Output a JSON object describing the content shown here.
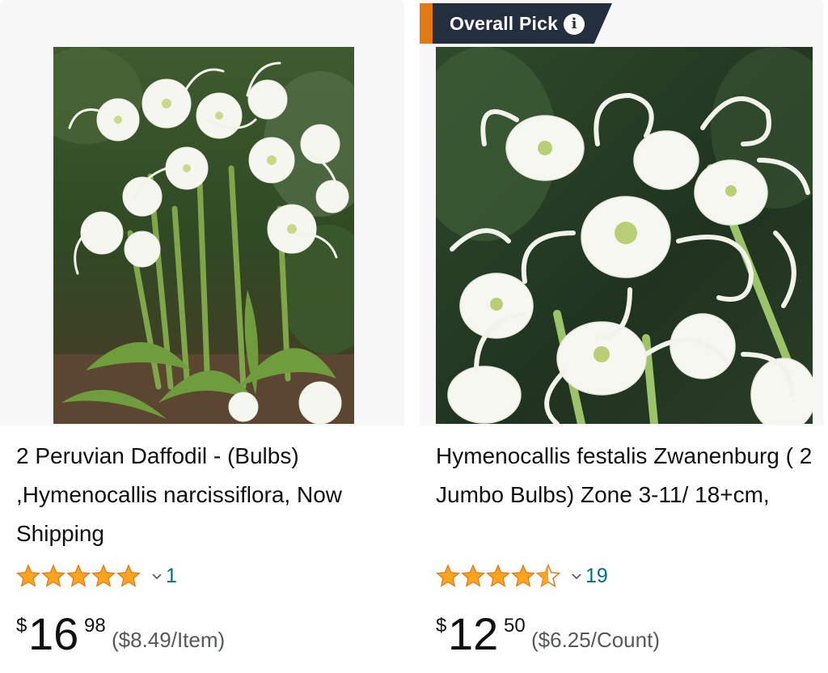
{
  "products": [
    {
      "image_alt": "Peruvian Daffodil white spider lily flowers",
      "title": "2 Peruvian Daffodil - (Bulbs) ,Hymenocallis narcissiflora, Now Shipping",
      "rating": 5.0,
      "rating_count": "1",
      "price_symbol": "$",
      "price_whole": "16",
      "price_fraction": "98",
      "unit_price": "($8.49/Item)"
    },
    {
      "badge": {
        "label": "Overall Pick",
        "info_icon": "info-icon",
        "stripe_color": "#e47911",
        "body_color": "#232f3e"
      },
      "image_alt": "Hymenocallis festalis white curly flowers",
      "title": "Hymenocallis festalis Zwanenburg ( 2 Jumbo Bulbs) Zone 3-11/ 18+cm,",
      "rating": 4.5,
      "rating_count": "19",
      "price_symbol": "$",
      "price_whole": "12",
      "price_fraction": "50",
      "unit_price": "($6.25/Count)"
    }
  ],
  "colors": {
    "star": "#ffa41c",
    "star_outline": "#de7921",
    "link": "#007185",
    "muted": "#565959",
    "text": "#0f1111"
  }
}
